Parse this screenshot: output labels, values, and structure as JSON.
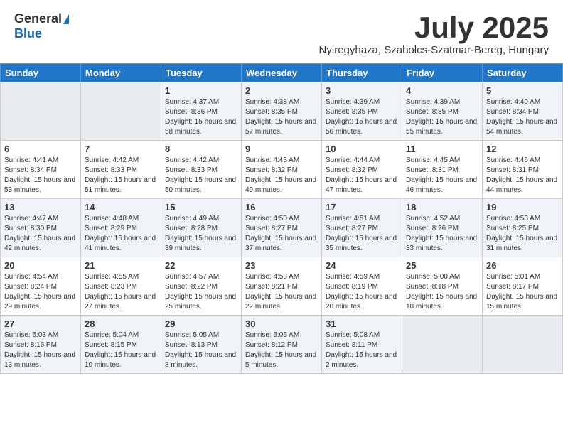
{
  "logo": {
    "general": "General",
    "blue": "Blue"
  },
  "title": "July 2025",
  "subtitle": "Nyiregyhaza, Szabolcs-Szatmar-Bereg, Hungary",
  "weekdays": [
    "Sunday",
    "Monday",
    "Tuesday",
    "Wednesday",
    "Thursday",
    "Friday",
    "Saturday"
  ],
  "weeks": [
    [
      {
        "day": "",
        "info": ""
      },
      {
        "day": "",
        "info": ""
      },
      {
        "day": "1",
        "info": "Sunrise: 4:37 AM\nSunset: 8:36 PM\nDaylight: 15 hours and 58 minutes."
      },
      {
        "day": "2",
        "info": "Sunrise: 4:38 AM\nSunset: 8:35 PM\nDaylight: 15 hours and 57 minutes."
      },
      {
        "day": "3",
        "info": "Sunrise: 4:39 AM\nSunset: 8:35 PM\nDaylight: 15 hours and 56 minutes."
      },
      {
        "day": "4",
        "info": "Sunrise: 4:39 AM\nSunset: 8:35 PM\nDaylight: 15 hours and 55 minutes."
      },
      {
        "day": "5",
        "info": "Sunrise: 4:40 AM\nSunset: 8:34 PM\nDaylight: 15 hours and 54 minutes."
      }
    ],
    [
      {
        "day": "6",
        "info": "Sunrise: 4:41 AM\nSunset: 8:34 PM\nDaylight: 15 hours and 53 minutes."
      },
      {
        "day": "7",
        "info": "Sunrise: 4:42 AM\nSunset: 8:33 PM\nDaylight: 15 hours and 51 minutes."
      },
      {
        "day": "8",
        "info": "Sunrise: 4:42 AM\nSunset: 8:33 PM\nDaylight: 15 hours and 50 minutes."
      },
      {
        "day": "9",
        "info": "Sunrise: 4:43 AM\nSunset: 8:32 PM\nDaylight: 15 hours and 49 minutes."
      },
      {
        "day": "10",
        "info": "Sunrise: 4:44 AM\nSunset: 8:32 PM\nDaylight: 15 hours and 47 minutes."
      },
      {
        "day": "11",
        "info": "Sunrise: 4:45 AM\nSunset: 8:31 PM\nDaylight: 15 hours and 46 minutes."
      },
      {
        "day": "12",
        "info": "Sunrise: 4:46 AM\nSunset: 8:31 PM\nDaylight: 15 hours and 44 minutes."
      }
    ],
    [
      {
        "day": "13",
        "info": "Sunrise: 4:47 AM\nSunset: 8:30 PM\nDaylight: 15 hours and 42 minutes."
      },
      {
        "day": "14",
        "info": "Sunrise: 4:48 AM\nSunset: 8:29 PM\nDaylight: 15 hours and 41 minutes."
      },
      {
        "day": "15",
        "info": "Sunrise: 4:49 AM\nSunset: 8:28 PM\nDaylight: 15 hours and 39 minutes."
      },
      {
        "day": "16",
        "info": "Sunrise: 4:50 AM\nSunset: 8:27 PM\nDaylight: 15 hours and 37 minutes."
      },
      {
        "day": "17",
        "info": "Sunrise: 4:51 AM\nSunset: 8:27 PM\nDaylight: 15 hours and 35 minutes."
      },
      {
        "day": "18",
        "info": "Sunrise: 4:52 AM\nSunset: 8:26 PM\nDaylight: 15 hours and 33 minutes."
      },
      {
        "day": "19",
        "info": "Sunrise: 4:53 AM\nSunset: 8:25 PM\nDaylight: 15 hours and 31 minutes."
      }
    ],
    [
      {
        "day": "20",
        "info": "Sunrise: 4:54 AM\nSunset: 8:24 PM\nDaylight: 15 hours and 29 minutes."
      },
      {
        "day": "21",
        "info": "Sunrise: 4:55 AM\nSunset: 8:23 PM\nDaylight: 15 hours and 27 minutes."
      },
      {
        "day": "22",
        "info": "Sunrise: 4:57 AM\nSunset: 8:22 PM\nDaylight: 15 hours and 25 minutes."
      },
      {
        "day": "23",
        "info": "Sunrise: 4:58 AM\nSunset: 8:21 PM\nDaylight: 15 hours and 22 minutes."
      },
      {
        "day": "24",
        "info": "Sunrise: 4:59 AM\nSunset: 8:19 PM\nDaylight: 15 hours and 20 minutes."
      },
      {
        "day": "25",
        "info": "Sunrise: 5:00 AM\nSunset: 8:18 PM\nDaylight: 15 hours and 18 minutes."
      },
      {
        "day": "26",
        "info": "Sunrise: 5:01 AM\nSunset: 8:17 PM\nDaylight: 15 hours and 15 minutes."
      }
    ],
    [
      {
        "day": "27",
        "info": "Sunrise: 5:03 AM\nSunset: 8:16 PM\nDaylight: 15 hours and 13 minutes."
      },
      {
        "day": "28",
        "info": "Sunrise: 5:04 AM\nSunset: 8:15 PM\nDaylight: 15 hours and 10 minutes."
      },
      {
        "day": "29",
        "info": "Sunrise: 5:05 AM\nSunset: 8:13 PM\nDaylight: 15 hours and 8 minutes."
      },
      {
        "day": "30",
        "info": "Sunrise: 5:06 AM\nSunset: 8:12 PM\nDaylight: 15 hours and 5 minutes."
      },
      {
        "day": "31",
        "info": "Sunrise: 5:08 AM\nSunset: 8:11 PM\nDaylight: 15 hours and 2 minutes."
      },
      {
        "day": "",
        "info": ""
      },
      {
        "day": "",
        "info": ""
      }
    ]
  ]
}
